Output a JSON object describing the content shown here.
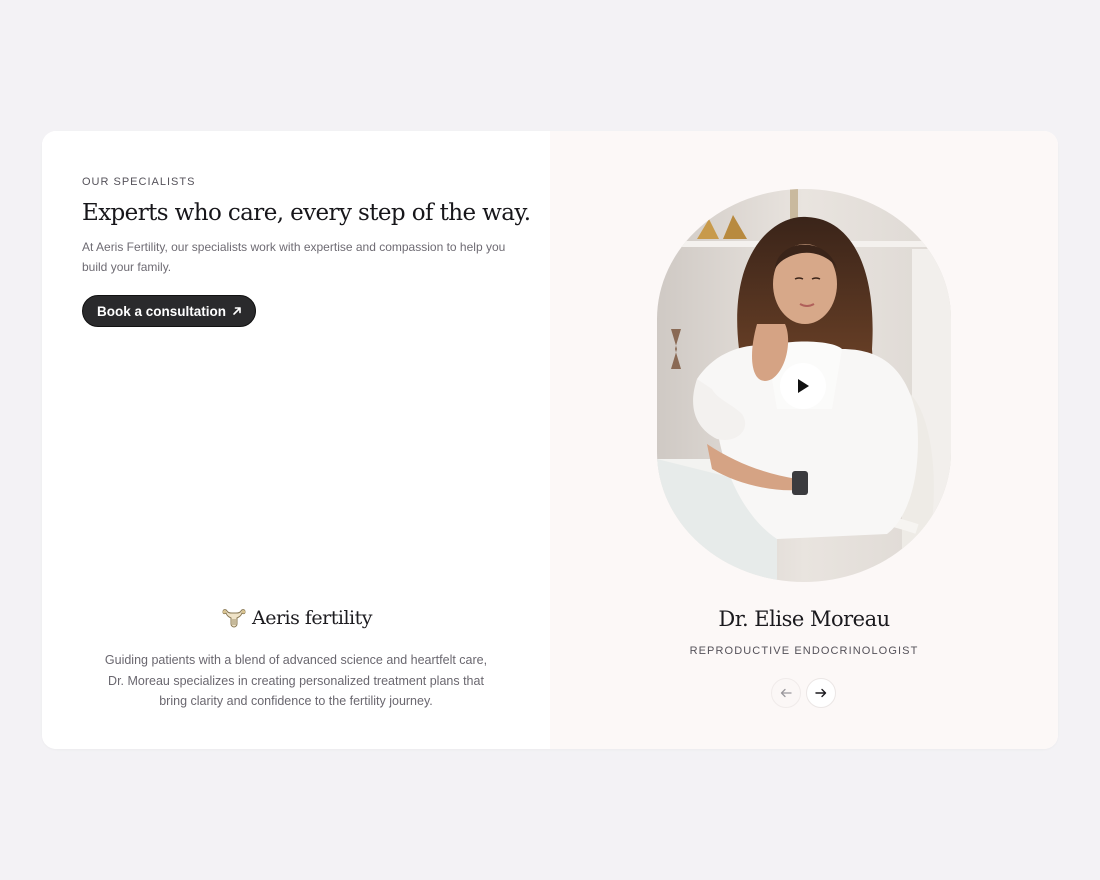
{
  "section": {
    "eyebrow": "OUR SPECIALISTS",
    "headline": "Experts who care, every step of the way.",
    "intro": "At Aeris Fertility, our specialists work with expertise and compassion to help you build your family.",
    "cta_label": "Book a consultation",
    "cta_icon": "arrow-up-right-icon"
  },
  "brand": {
    "name": "Aeris fertility",
    "logo_icon": "uterus-logo-icon"
  },
  "specialist": {
    "bio": "Guiding patients with a blend of advanced science and heartfelt care, Dr. Moreau specializes in creating personalized treatment plans that bring clarity and confidence to the fertility journey.",
    "name": "Dr. Elise Moreau",
    "role": "REPRODUCTIVE ENDOCRINOLOGIST",
    "video_icon": "play-icon"
  },
  "carousel": {
    "prev_icon": "arrow-left-icon",
    "next_icon": "arrow-right-icon"
  },
  "colors": {
    "page_bg": "#f3f2f5",
    "card_bg": "#ffffff",
    "panel_bg": "#fcf8f7",
    "cta_bg": "#2a2a2c",
    "text_primary": "#17161a",
    "text_muted": "#6e6b73"
  }
}
